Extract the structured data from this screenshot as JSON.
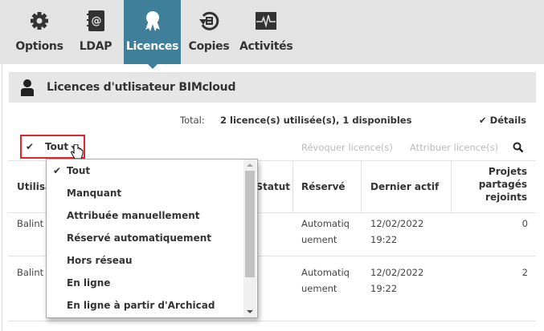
{
  "nav": {
    "tabs": [
      {
        "label": "Options",
        "icon": "gear-icon"
      },
      {
        "label": "LDAP",
        "icon": "address-book-icon"
      },
      {
        "label": "Licences",
        "icon": "ribbon-award-icon",
        "active": true
      },
      {
        "label": "Copies",
        "icon": "backup-history-icon"
      },
      {
        "label": "Activités",
        "icon": "activity-monitor-icon"
      }
    ]
  },
  "section": {
    "title": "Licences d'utlisateur BIMcloud",
    "icon": "user-icon"
  },
  "summary": {
    "label": "Total:",
    "value": "2 licence(s) utilisée(s), 1 disponibles",
    "details": "Détails"
  },
  "filter": {
    "check": "✔",
    "value": "Tout"
  },
  "actions": {
    "revoke": "Révoquer licence(s)",
    "assign": "Attribuer licence(s)"
  },
  "table": {
    "headers": [
      "Utilisateur",
      "Statut",
      "Réservé",
      "Dernier actif",
      "Projets partagés rejoints"
    ],
    "rows": [
      {
        "user": "Balint",
        "reserved1": "Automatiq",
        "reserved2": "uement",
        "date": "12/02/2022",
        "time": "19:22",
        "projects": "0"
      },
      {
        "user": "Balint",
        "reserved1": "Automatiq",
        "reserved2": "uement",
        "date": "12/02/2022",
        "time": "19:22",
        "projects": "2"
      }
    ]
  },
  "dropdown": {
    "selected": "Tout",
    "items": [
      "Tout",
      "Manquant",
      "Attribuée manuellement",
      "Réservé automatiquement",
      "Hors réseau",
      "En ligne",
      "En ligne à partir d'Archicad"
    ]
  },
  "colors": {
    "accent": "#3f7f99",
    "highlight": "#e8222a"
  }
}
